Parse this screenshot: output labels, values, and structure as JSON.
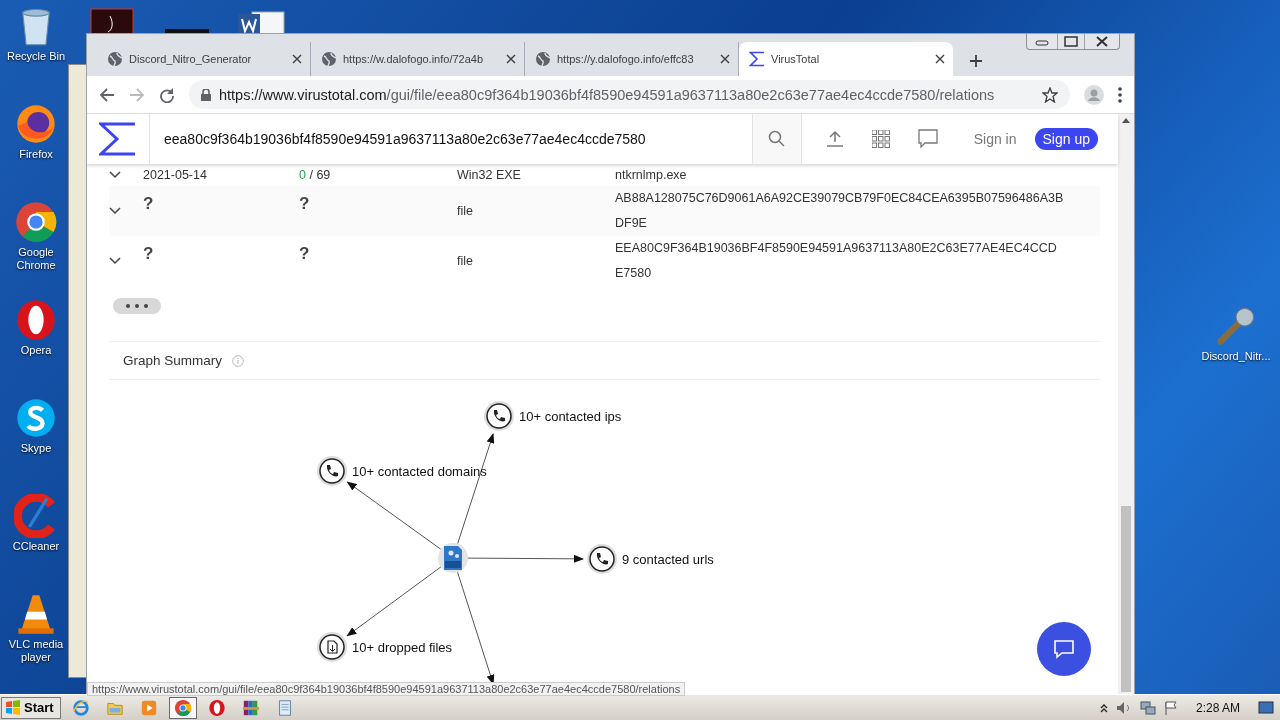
{
  "desktop": {
    "icons": [
      {
        "label": "Recycle Bin",
        "kind": "recycle"
      },
      {
        "label": "Firefox",
        "kind": "firefox"
      },
      {
        "label": "Google Chrome",
        "kind": "chrome"
      },
      {
        "label": "Opera",
        "kind": "opera"
      },
      {
        "label": "Skype",
        "kind": "skype"
      },
      {
        "label": "CCleaner",
        "kind": "ccleaner"
      },
      {
        "label": "VLC media player",
        "kind": "vlc"
      }
    ],
    "right_icons": [
      {
        "label": "Discord_Nitr...",
        "kind": "tool"
      }
    ]
  },
  "browser": {
    "tabs": [
      {
        "title": "Discord_Nitro_Generator",
        "kind": "globe",
        "selected": false
      },
      {
        "title": "https://w.dalofogo.info/72a4b",
        "kind": "globe",
        "selected": false
      },
      {
        "title": "https://y.dalofogo.info/effc83",
        "kind": "globe",
        "selected": false
      },
      {
        "title": "VirusTotal",
        "kind": "virustotal",
        "selected": true
      }
    ],
    "address": {
      "host": "https://www.virustotal.com",
      "path": "/gui/file/eea80c9f364b19036bf4f8590e94591a9637113a80e2c63e77ae4ec4ccde7580/relations"
    },
    "status_url": "https://www.virustotal.com/gui/file/eea80c9f364b19036bf4f8590e94591a9637113a80e2c63e77ae4ec4ccde7580/relations"
  },
  "virustotal": {
    "search": {
      "value": "eea80c9f364b19036bf4f8590e94591a9637113a80e2c63e77ae4ec4ccde7580"
    },
    "sign_in": "Sign in",
    "sign_up": "Sign up",
    "rows": [
      {
        "date": "2021-05-14",
        "detections": "0",
        "detections_total": "/ 69",
        "type": "Win32 EXE",
        "name": "ntkrnlmp.exe"
      },
      {
        "date": "?",
        "detections": "?",
        "type": "file",
        "name": "AB88A128075C76D9061A6A92CE39079CB79F0EC84CEA6395B07596486A3BDF9E"
      },
      {
        "date": "?",
        "detections": "?",
        "type": "file",
        "name": "EEA80C9F364B19036BF4F8590E94591A9637113A80E2C63E77AE4EC4CCDE7580"
      }
    ],
    "graph_summary": {
      "title": "Graph Summary",
      "nodes": [
        {
          "label": "10+ contacted ips",
          "kind": "contacted"
        },
        {
          "label": "10+ contacted domains",
          "kind": "contacted"
        },
        {
          "label": "9 contacted urls",
          "kind": "contacted"
        },
        {
          "label": "10+ dropped files",
          "kind": "dropped"
        }
      ]
    }
  },
  "taskbar": {
    "start": "Start",
    "apps": [
      {
        "kind": "ie",
        "selected": false
      },
      {
        "kind": "explorer",
        "selected": false
      },
      {
        "kind": "media",
        "selected": false
      },
      {
        "kind": "chrome",
        "selected": true
      },
      {
        "kind": "opera",
        "selected": false
      },
      {
        "kind": "winrar",
        "selected": false
      },
      {
        "kind": "notepad",
        "selected": false
      }
    ],
    "clock": "2:28 AM"
  }
}
